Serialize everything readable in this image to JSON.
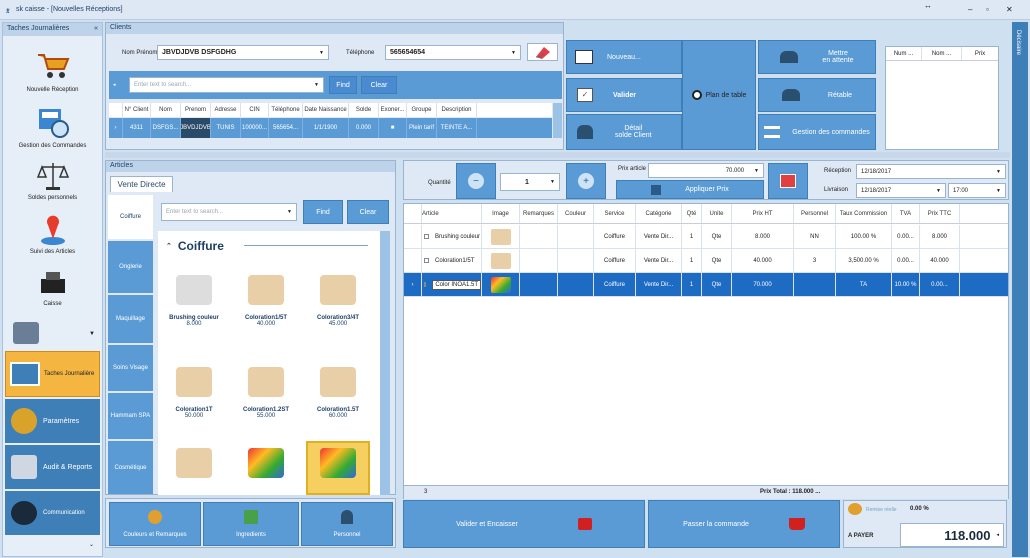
{
  "window": {
    "title": "sk caisse - [Nouvelles Réceptions]",
    "sizer": "↔",
    "min": "–",
    "max": "▫",
    "close": "✕"
  },
  "sidebar": {
    "header": "Taches Journalières",
    "collapse": "«",
    "items": [
      "Nouvelle Réception",
      "Gestion des Commandes",
      "Soldes personnels",
      "Suivi des Articles",
      "Caisse"
    ],
    "groups": [
      "Taches Journalière",
      "Paramètres",
      "Audit & Reports",
      "Communication"
    ]
  },
  "right_strip": {
    "label": "Décisaire"
  },
  "clients": {
    "title": "Clients",
    "name_label": "Nom Prénom",
    "name_value": "JBVDJDVB DSFGDHG",
    "phone_label": "Téléphone",
    "phone_value": "565654654",
    "search_placeholder": "Enter text to search...",
    "find": "Find",
    "clear": "Clear",
    "columns": [
      "N° Client",
      "Nom",
      "Prenom",
      "Adresse",
      "CIN",
      "Téléphone",
      "Date Naissance",
      "Solde",
      "Exoner...",
      "Groupe",
      "Description"
    ],
    "row": [
      "4311",
      "DSFGS...",
      "JBVDJDVB",
      "TUNIS",
      "100000...",
      "565654...",
      "1/1/1900",
      "0.000",
      "■",
      "Plein tarif",
      "TEINTE A..."
    ]
  },
  "actions": {
    "nouveau": "Nouveau...",
    "mettre": "Mettre\nen attente",
    "valider": "Valider",
    "plan": "Plan de table",
    "retable": "Rétable",
    "detail": "Détail\nsolde Client",
    "gestion": "Gestion des commandes"
  },
  "mini_table": {
    "columns": [
      "Num ...",
      "Nom ...",
      "Prix"
    ]
  },
  "articles": {
    "title": "Articles",
    "tab": "Vente Directe",
    "search_placeholder": "Enter text to search...",
    "find": "Find",
    "clear": "Clear",
    "categories": [
      "Coiffure",
      "Onglerie",
      "Maquillage",
      "Soins Visage",
      "Hammam SPA",
      "Cosmétique"
    ],
    "group_title": "Coiffure",
    "items": [
      {
        "name": "Brushing couleur",
        "price": "8.000"
      },
      {
        "name": "Coloration1/5T",
        "price": "40.000"
      },
      {
        "name": "Coloration3/4T",
        "price": "45.000"
      },
      {
        "name": "Coloration1T",
        "price": "50.000"
      },
      {
        "name": "Coloration1.2ST",
        "price": "55.000"
      },
      {
        "name": "Coloration1.5T",
        "price": "60.000"
      },
      {
        "name": "",
        "price": ""
      },
      {
        "name": "",
        "price": ""
      },
      {
        "name": "",
        "price": ""
      }
    ]
  },
  "bottom_left": {
    "couleurs": "Couleurs et Remarques",
    "ingredients": "Ingredients",
    "personnel": "Personnel"
  },
  "order": {
    "quantite_label": "Quantité",
    "quantite": "1",
    "minus": "−",
    "plus": "+",
    "prix_label": "Prix article :",
    "prix": "70.000",
    "appliquer": "Appliquer Prix",
    "reception_label": "Réception",
    "reception": "12/18/2017",
    "livraison_label": "Livraison",
    "livraison": "12/18/2017",
    "heure": "17:00",
    "columns": [
      "Article",
      "Image",
      "Remarques",
      "Couleur",
      "Service",
      "Catégorie",
      "Qté",
      "Unite",
      "Prix HT",
      "Personnel",
      "Taux Commission",
      "TVA",
      "Prix TTC"
    ],
    "rows": [
      [
        "Brushing couleur",
        "",
        "",
        "",
        "Coiffure",
        "Vente Dir...",
        "1",
        "Qte",
        "8.000",
        "NN",
        "100.00 %",
        "0.00...",
        "8.000"
      ],
      [
        "Coloration1/5T",
        "",
        "",
        "",
        "Coiffure",
        "Vente Dir...",
        "1",
        "Qte",
        "40.000",
        "3",
        "3,500.00 %",
        "0.00...",
        "40.000"
      ],
      [
        "Color INOA1.5T",
        "",
        "",
        "",
        "Coiffure",
        "Vente Dir...",
        "1",
        "Qte",
        "70.000",
        "",
        "TA",
        "10.00 %",
        "0.00...",
        "70.000"
      ]
    ],
    "count": "3",
    "total": "Prix Total : 118.000 ...",
    "valider": "Valider et Encaisser",
    "passer": "Passer la commande",
    "remise_label": "Remise réelle",
    "remise": "0.00 %",
    "apayer_label": "A PAYER",
    "apayer": "118.000"
  },
  "colors": {
    "accent": "#5b9bd5",
    "selected": "#1e6bc4",
    "sidebar_active": "#f5b641"
  }
}
